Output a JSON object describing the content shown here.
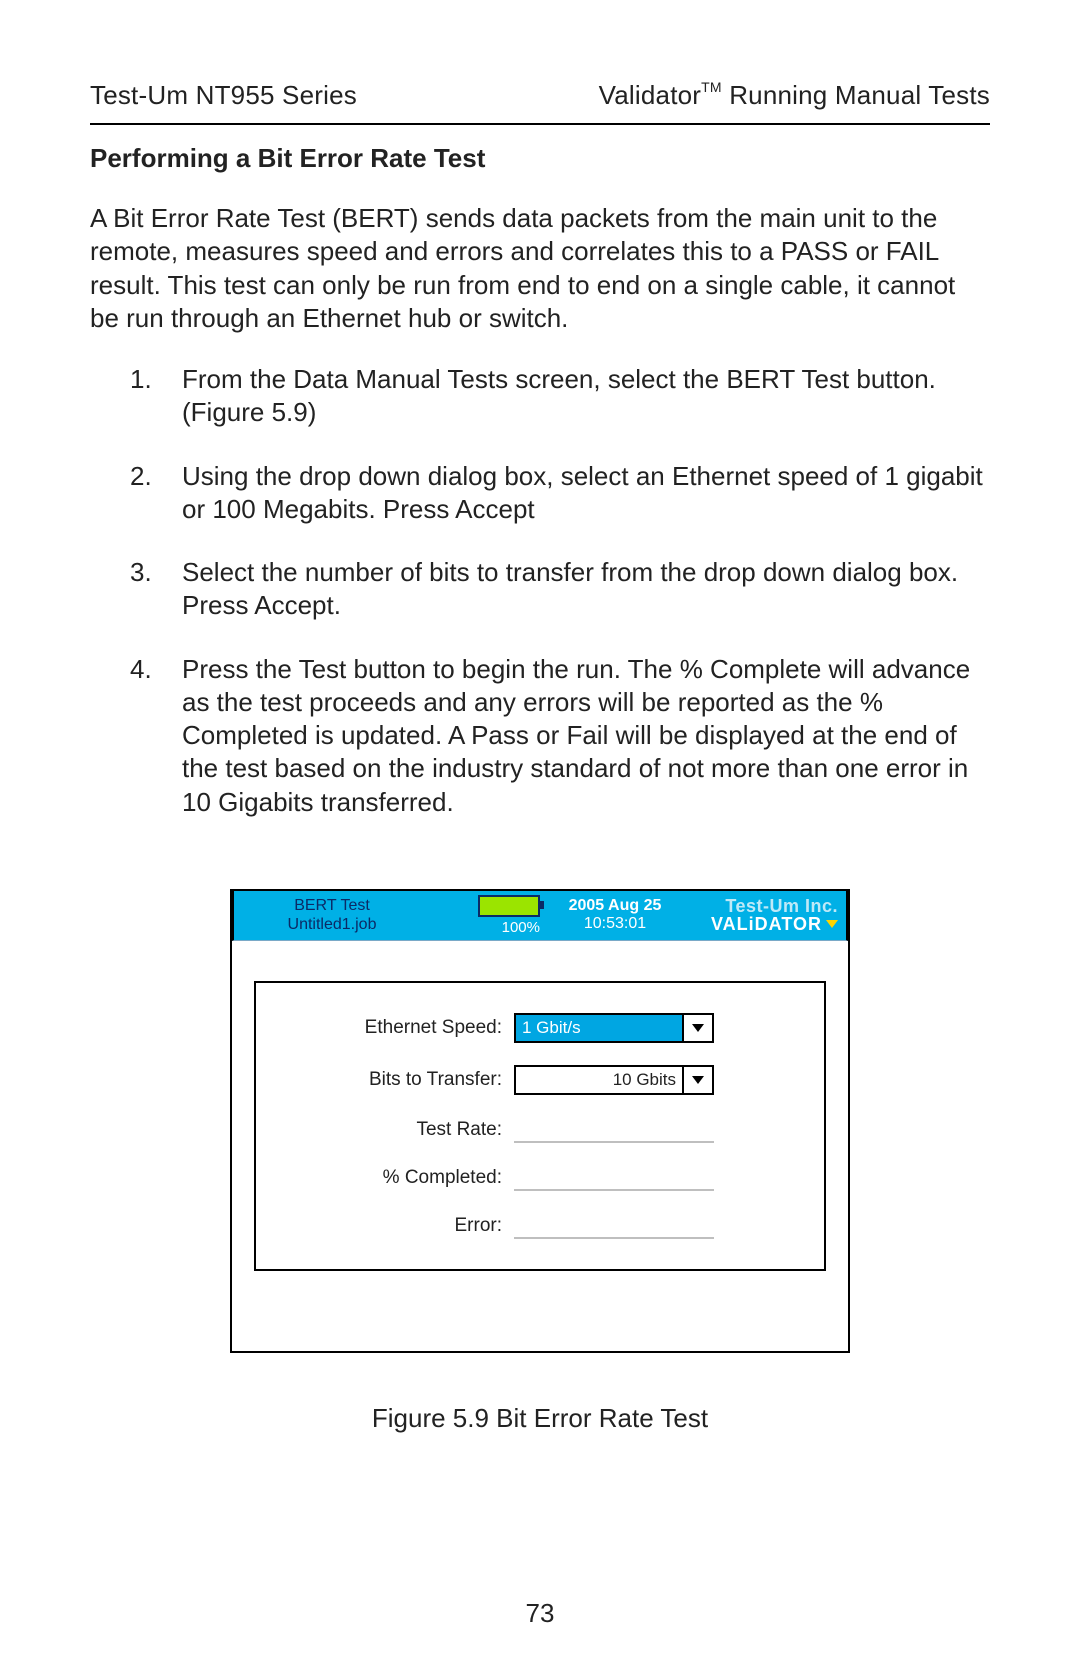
{
  "header": {
    "left": "Test-Um NT955 Series",
    "right_prefix": "Validator",
    "right_tm": "TM",
    "right_suffix": " Running Manual Tests"
  },
  "section_title": "Performing a Bit Error Rate Test",
  "intro": "A Bit Error Rate Test (BERT) sends data packets from the main unit to the remote, measures speed and errors and correlates this to a PASS or FAIL result. This test can only be run from end to end on a single cable, it cannot be run through an Ethernet hub or switch.",
  "steps": [
    "From the Data Manual Tests screen, select the BERT Test button. (Figure 5.9)",
    "Using the drop down dialog box, select an Ethernet speed of 1 gigabit or 100 Megabits. Press Accept",
    "Select the number of bits to transfer from the drop down dialog box. Press Accept.",
    "Press the Test button to begin the run.  The % Complete will advance as the test proceeds and any errors will be reported as the % Completed is updated.  A Pass or Fail will be displayed at the end of the test based on the industry standard of not more than one error in 10 Gigabits transferred."
  ],
  "bert": {
    "title1": "BERT Test",
    "title2": "Untitled1.job",
    "battery_pct": "100%",
    "date": "2005 Aug 25",
    "time": "10:53:01",
    "brand1": "Test-Um Inc.",
    "brand2": "VALiDATOR",
    "fields": {
      "ethernet_speed_label": "Ethernet Speed:",
      "ethernet_speed_value": "1 Gbit/s",
      "bits_label": "Bits to Transfer:",
      "bits_value": "10 Gbits",
      "test_rate_label": "Test Rate:",
      "pct_completed_label": "% Completed:",
      "error_label": "Error:"
    }
  },
  "figure_caption": "Figure 5.9 Bit Error Rate Test",
  "page_number": "73"
}
